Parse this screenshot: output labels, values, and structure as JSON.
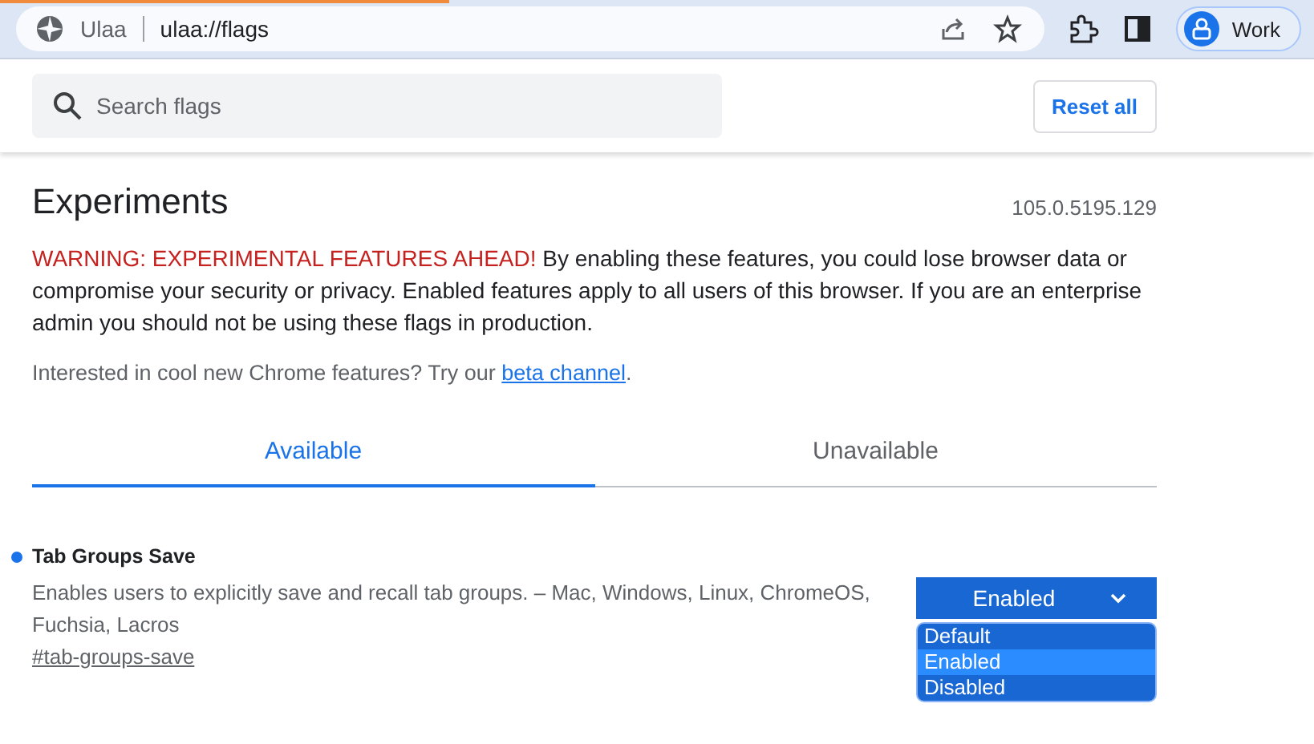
{
  "browser": {
    "site_name": "Ulaa",
    "url": "ulaa://flags",
    "profile": "Work"
  },
  "header": {
    "search": {
      "placeholder": "Search flags"
    },
    "reset_button": "Reset all"
  },
  "page": {
    "title": "Experiments",
    "version": "105.0.5195.129",
    "warning": {
      "alert": "WARNING: EXPERIMENTAL FEATURES AHEAD!",
      "text": " By enabling these features, you could lose browser data or compromise your security or privacy. Enabled features apply to all users of this browser. If you are an enterprise admin you should not be using these flags in production."
    },
    "promo": {
      "text": "Interested in cool new Chrome features? Try our ",
      "link": "beta channel",
      "end": "."
    }
  },
  "tabs": [
    {
      "label": "Available",
      "selected": true
    },
    {
      "label": "Unavailable",
      "selected": false
    }
  ],
  "flags": [
    {
      "name": "Tab Groups Save",
      "modified": true,
      "description": "Enables users to explicitly save and recall tab groups. – Mac, Windows, Linux, ChromeOS, Fuchsia, Lacros",
      "anchor": "#tab-groups-save",
      "value": "Enabled",
      "dropdown_open": true,
      "options": [
        {
          "label": "Default",
          "selected": false
        },
        {
          "label": "Enabled",
          "selected": true
        },
        {
          "label": "Disabled",
          "selected": false
        }
      ]
    }
  ]
}
